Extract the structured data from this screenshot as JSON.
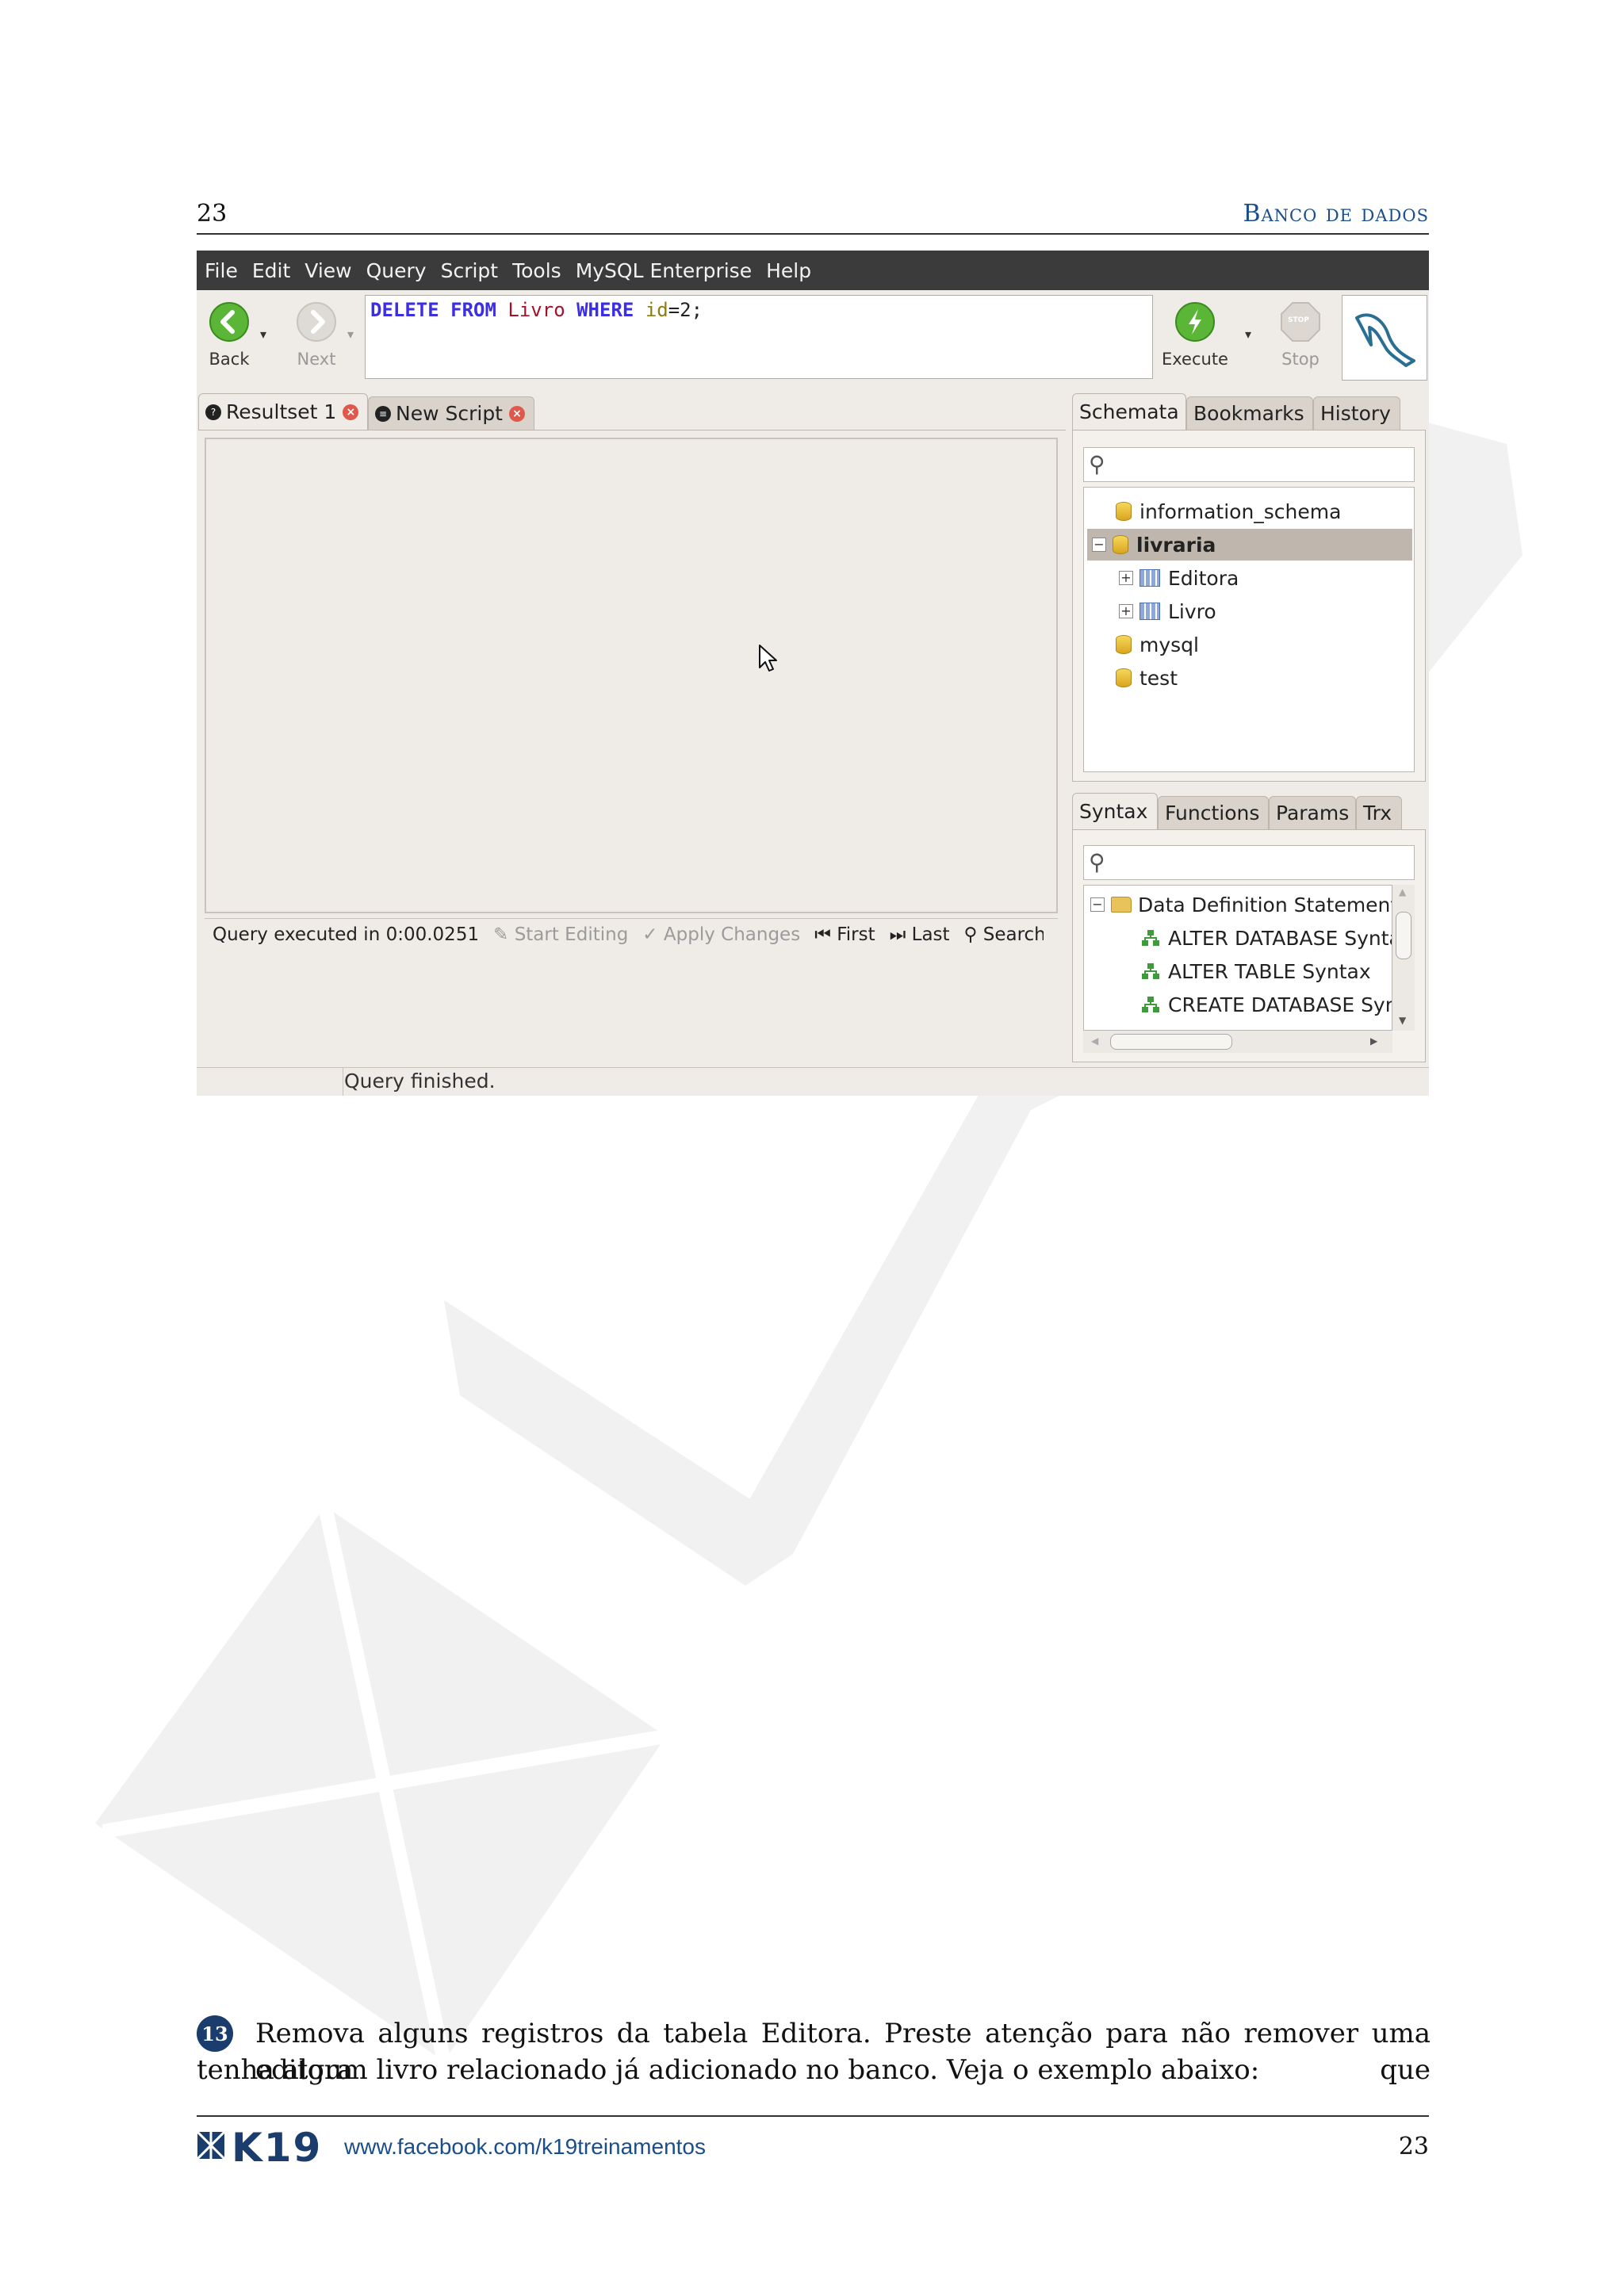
{
  "header": {
    "page_number": "23",
    "chapter_title": "Banco de dados"
  },
  "app": {
    "menu": [
      "File",
      "Edit",
      "View",
      "Query",
      "Script",
      "Tools",
      "MySQL Enterprise",
      "Help"
    ],
    "toolbar": {
      "back": "Back",
      "next": "Next",
      "execute": "Execute",
      "stop": "Stop",
      "stop_icon_text": "STOP"
    },
    "sql": {
      "kw1": "DELETE",
      "kw2": "FROM",
      "table": "Livro",
      "kw3": "WHERE",
      "column": "id",
      "rest": "=2;"
    },
    "tabs": [
      {
        "label": "Resultset 1"
      },
      {
        "label": "New Script"
      }
    ],
    "result_bar": {
      "exec_time": "Query executed in 0:00.0251",
      "start_editing": "Start Editing",
      "apply_changes": "Apply Changes",
      "first": "First",
      "last": "Last",
      "search": "Search"
    },
    "status": "Query finished.",
    "schema_panel": {
      "tabs": [
        "Schemata",
        "Bookmarks",
        "History"
      ],
      "items": [
        {
          "label": "information_schema"
        },
        {
          "label": "livraria"
        },
        {
          "label": "Editora"
        },
        {
          "label": "Livro"
        },
        {
          "label": "mysql"
        },
        {
          "label": "test"
        }
      ]
    },
    "syntax_panel": {
      "tabs": [
        "Syntax",
        "Functions",
        "Params",
        "Trx"
      ],
      "items": [
        {
          "label": "Data Definition Statements"
        },
        {
          "label": "ALTER DATABASE Syntax"
        },
        {
          "label": "ALTER TABLE Syntax"
        },
        {
          "label": "CREATE DATABASE Syntax"
        }
      ]
    }
  },
  "caption": {
    "step": "13",
    "line1": "Remova alguns registros da tabela Editora. Preste atenção para não remover uma editora que",
    "line2": "tenha algum livro relacionado já adicionado no banco. Veja o exemplo abaixo:"
  },
  "footer": {
    "logo": "K19",
    "url": "www.facebook.com/k19treinamentos",
    "page_number": "23"
  }
}
